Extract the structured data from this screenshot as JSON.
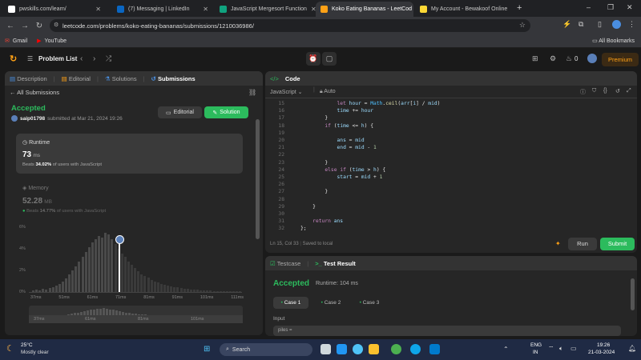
{
  "browser": {
    "tabs": [
      {
        "title": "pwskills.com/learn/",
        "color": "#ffffff",
        "active": false
      },
      {
        "title": "(7) Messaging | LinkedIn",
        "color": "#0a66c2",
        "active": false
      },
      {
        "title": "JavaScript Mergesort Function",
        "color": "#10a37f",
        "active": false
      },
      {
        "title": "Koko Eating Bananas - LeetCod",
        "color": "#ffa116",
        "active": true
      },
      {
        "title": "My Account - Bewakoof Online",
        "color": "#fdd835",
        "active": false
      }
    ],
    "url": "leetcode.com/problems/koko-eating-bananas/submissions/1210036986/",
    "bookmarks": {
      "gmail": "Gmail",
      "youtube": "YouTube",
      "all": "All Bookmarks"
    }
  },
  "header": {
    "problem_list": "Problem List",
    "fire_count": "0",
    "premium": "Premium"
  },
  "left": {
    "tabs": {
      "description": "Description",
      "editorial": "Editorial",
      "solutions": "Solutions",
      "submissions": "Submissions"
    },
    "all_submissions": "All Submissions",
    "status": "Accepted",
    "user": "saip01798",
    "submitted_text": "submitted at Mar 21, 2024 19:26",
    "editorial_btn": "Editorial",
    "solution_btn": "Solution",
    "runtime": {
      "label": "Runtime",
      "value": "73",
      "unit": "ms",
      "beats_prefix": "Beats",
      "beats_value": "34.02%",
      "beats_suffix": "of users with JavaScript"
    },
    "memory": {
      "label": "Memory",
      "value": "52.28",
      "unit": "MB",
      "beats_prefix": "Beats",
      "beats_value": "14.77%",
      "beats_suffix": "of users with JavaScript"
    },
    "chart": {
      "y_ticks": [
        "6%",
        "4%",
        "2%",
        "0%"
      ],
      "x_ticks": [
        "37ms",
        "51ms",
        "61ms",
        "71ms",
        "81ms",
        "91ms",
        "101ms",
        "111ms"
      ],
      "mini_ticks": [
        "37ms",
        "61ms",
        "81ms",
        "101ms"
      ]
    }
  },
  "code": {
    "title": "Code",
    "language": "JavaScript",
    "auto": "Auto",
    "lines": [
      {
        "n": "15",
        "t": "            let hour = Math.ceil(arr[i] / mid)"
      },
      {
        "n": "16",
        "t": "            time += hour"
      },
      {
        "n": "17",
        "t": "        }"
      },
      {
        "n": "18",
        "t": "        if (time <= h) {"
      },
      {
        "n": "19",
        "t": ""
      },
      {
        "n": "20",
        "t": "            ans = mid"
      },
      {
        "n": "21",
        "t": "            end = mid - 1"
      },
      {
        "n": "22",
        "t": ""
      },
      {
        "n": "23",
        "t": "        }"
      },
      {
        "n": "24",
        "t": "        else if (time > h) {"
      },
      {
        "n": "25",
        "t": "            start = mid + 1"
      },
      {
        "n": "26",
        "t": ""
      },
      {
        "n": "27",
        "t": "        }"
      },
      {
        "n": "28",
        "t": ""
      },
      {
        "n": "29",
        "t": "    }"
      },
      {
        "n": "30",
        "t": ""
      },
      {
        "n": "31",
        "t": "    return ans"
      },
      {
        "n": "32",
        "t": "};"
      }
    ],
    "cursor": "Ln 15, Col 33",
    "saved": "Saved to local",
    "run": "Run",
    "submit": "Submit"
  },
  "result": {
    "testcase_tab": "Testcase",
    "result_tab": "Test Result",
    "status": "Accepted",
    "runtime": "Runtime: 104 ms",
    "cases": [
      "Case 1",
      "Case 2",
      "Case 3"
    ],
    "input_label": "Input",
    "input_value": "piles ="
  },
  "taskbar": {
    "temp": "25°C",
    "weather": "Mostly clear",
    "search": "Search",
    "lang1": "ENG",
    "lang2": "IN",
    "time": "19:26",
    "date": "21-03-2024"
  }
}
